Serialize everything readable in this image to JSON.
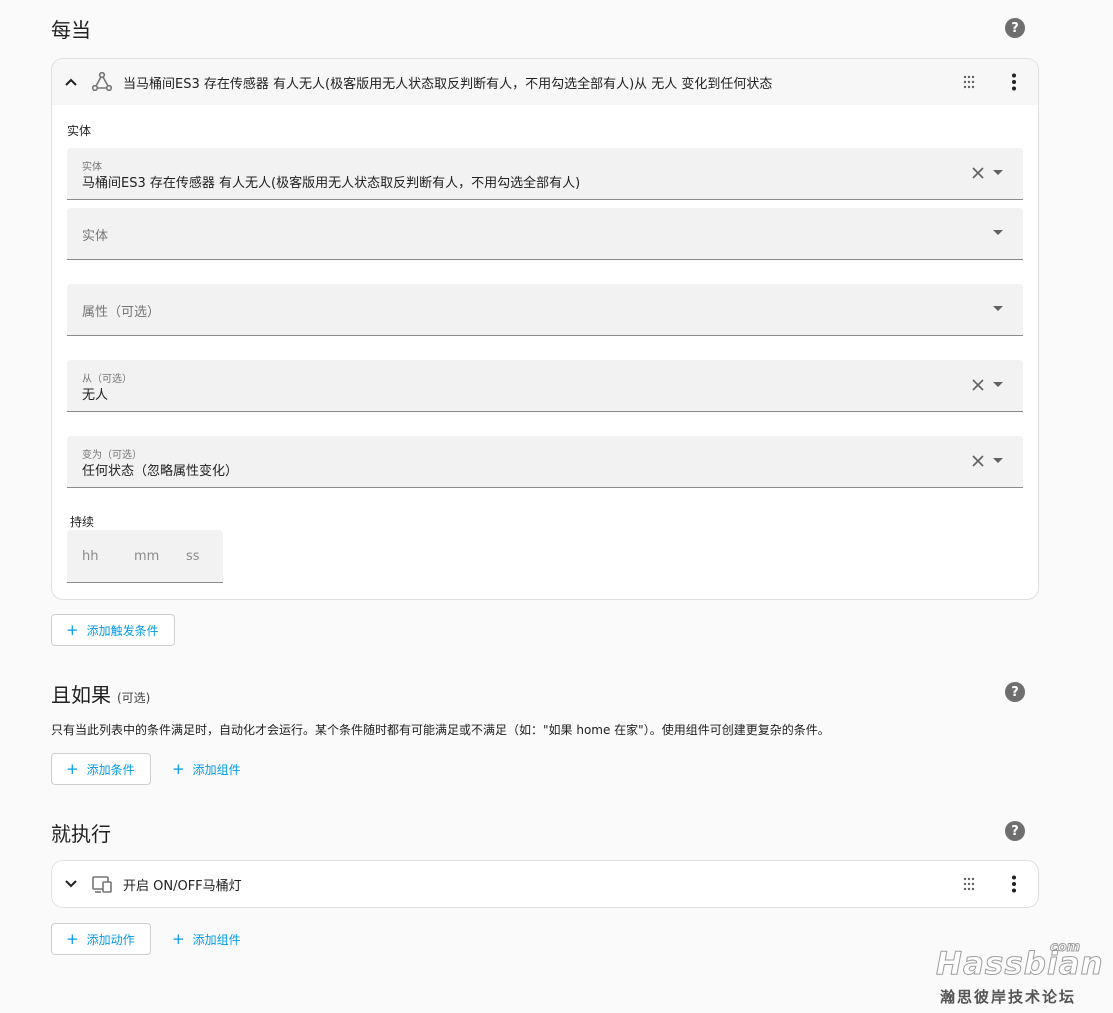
{
  "triggers": {
    "title": "每当",
    "help": "?",
    "card": {
      "title": "当马桶间ES3 存在传感器 有人无人(极客版用无人状态取反判断有人，不用勾选全部有人)从 无人 变化到任何状态",
      "section_label": "实体",
      "entity_field": {
        "label": "实体",
        "value": "马桶间ES3  存在传感器 有人无人(极客版用无人状态取反判断有人，不用勾选全部有人)"
      },
      "entity_field2": {
        "placeholder": "实体"
      },
      "attribute_field": {
        "placeholder": "属性（可选）"
      },
      "from_field": {
        "label": "从（可选）",
        "value": "无人"
      },
      "to_field": {
        "label": "变为（可选）",
        "value": "任何状态（忽略属性变化）"
      },
      "duration": {
        "label": "持续",
        "hh": "hh",
        "mm": "mm",
        "ss": "ss"
      }
    },
    "add_button": "添加触发条件"
  },
  "conditions": {
    "title": "且如果",
    "subtitle": "(可选)",
    "help": "?",
    "description": "只有当此列表中的条件满足时，自动化才会运行。某个条件随时都有可能满足或不满足（如：\"如果 home 在家\"）。使用组件可创建更复杂的条件。",
    "add_button": "添加条件",
    "add_block": "添加组件"
  },
  "actions": {
    "title": "就执行",
    "help": "?",
    "card": {
      "title": "开启 ON/OFF马桶灯"
    },
    "add_button": "添加动作",
    "add_block": "添加组件"
  },
  "watermark": {
    "brand": "Hassbian",
    "com": "com",
    "tagline": "瀚思彼岸技术论坛"
  },
  "colors": {
    "accent": "#039be5",
    "background": "#fafafa",
    "field_bg": "#f2f2f2"
  },
  "icons": {
    "collapse": "chevron-up-icon",
    "expand": "chevron-down-icon",
    "trigger_state": "state-trigger-icon",
    "action_device": "device-icon",
    "drag": "drag-handle-icon",
    "menu": "kebab-menu-icon"
  }
}
